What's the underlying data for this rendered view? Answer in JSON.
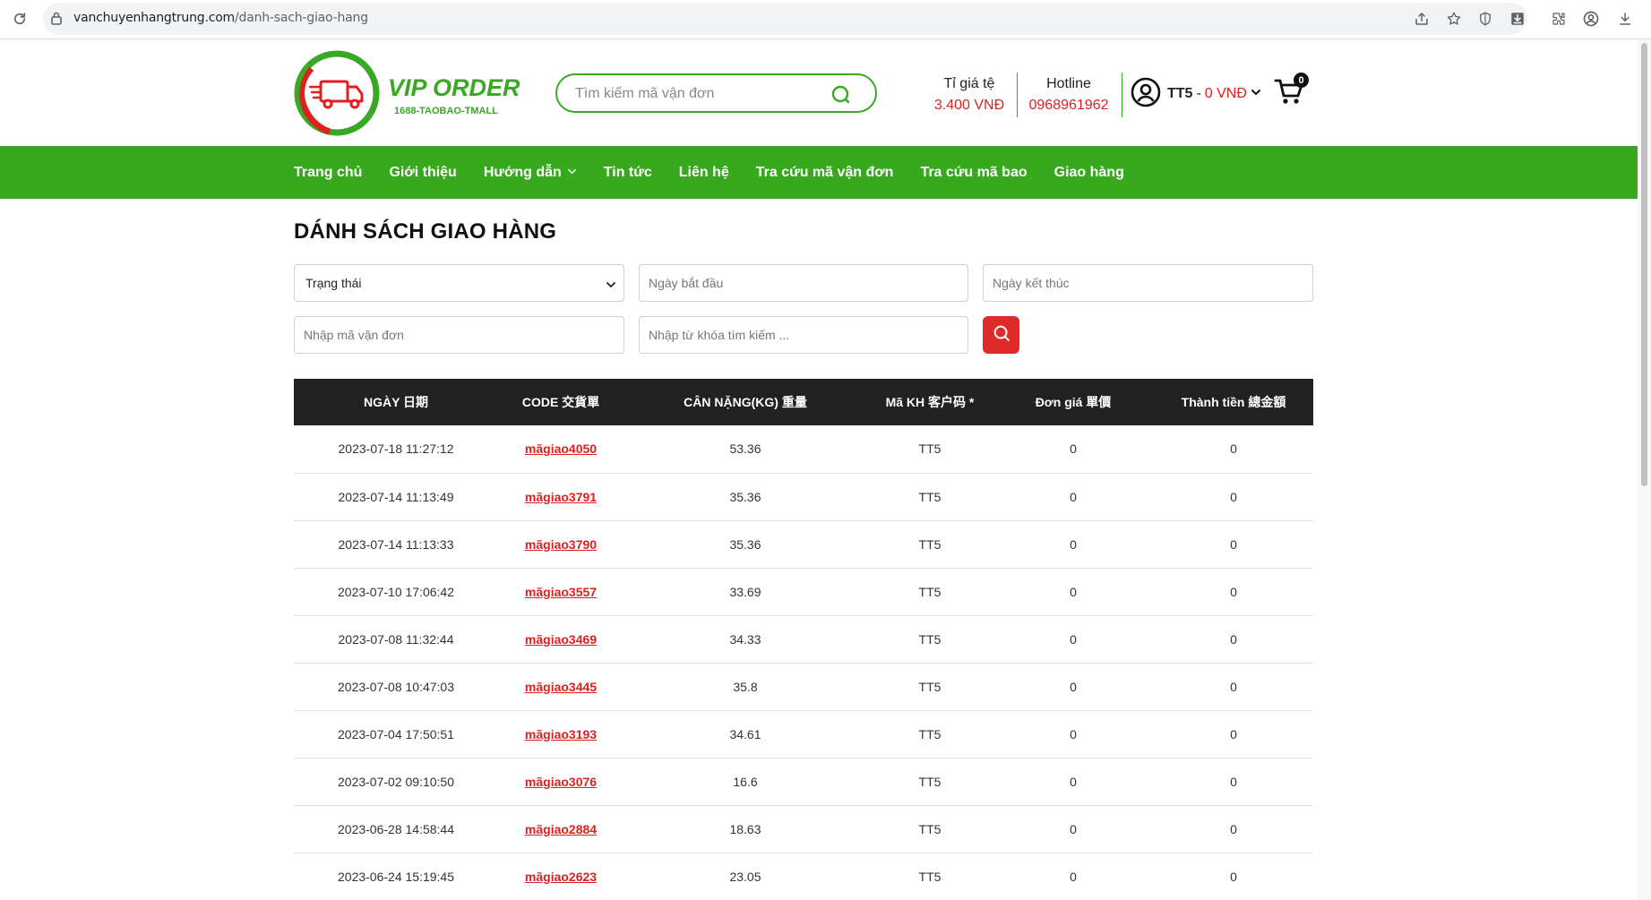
{
  "browser": {
    "url_domain": "vanchuyenhangtrung.com",
    "url_path": "/danh-sach-giao-hang"
  },
  "header": {
    "logo_title": "VIP ORDER",
    "logo_subtitle": "1688-TAOBAO-TMALL",
    "search_placeholder": "Tìm kiếm mã vận đơn",
    "rate_label": "Tỉ giá tệ",
    "rate_value": "3.400 VNĐ",
    "hotline_label": "Hotline",
    "hotline_value": "0968961962",
    "account_name": "TT5",
    "account_sep": "-",
    "account_balance": "0 VNĐ",
    "cart_count": "0"
  },
  "nav": {
    "items": [
      "Trang chủ",
      "Giới thiệu",
      "Hướng dẫn",
      "Tin tức",
      "Liên hệ",
      "Tra cứu mã vận đơn",
      "Tra cứu mã bao",
      "Giao hàng"
    ]
  },
  "main": {
    "title": "DÁNH SÁCH GIAO HÀNG",
    "filters": {
      "status_selected": "Trạng thái",
      "start_date_placeholder": "Ngày bắt đầu",
      "end_date_placeholder": "Ngày kết thúc",
      "code_placeholder": "Nhập mã vận đơn",
      "keyword_placeholder": "Nhập từ khóa tìm kiếm ..."
    },
    "table": {
      "headers": [
        "NGÀY 日期",
        "CODE 交貨單",
        "CÂN NẶNG(KG) 重量",
        "Mã KH 客户码 *",
        "Đơn giá 單價",
        "Thành tiền 總金額"
      ],
      "rows": [
        [
          "2023-07-18 11:27:12",
          "mãgiao4050",
          "53.36",
          "TT5",
          "0",
          "0"
        ],
        [
          "2023-07-14 11:13:49",
          "mãgiao3791",
          "35.36",
          "TT5",
          "0",
          "0"
        ],
        [
          "2023-07-14 11:13:33",
          "mãgiao3790",
          "35.36",
          "TT5",
          "0",
          "0"
        ],
        [
          "2023-07-10 17:06:42",
          "mãgiao3557",
          "33.69",
          "TT5",
          "0",
          "0"
        ],
        [
          "2023-07-08 11:32:44",
          "mãgiao3469",
          "34.33",
          "TT5",
          "0",
          "0"
        ],
        [
          "2023-07-08 10:47:03",
          "mãgiao3445",
          "35.8",
          "TT5",
          "0",
          "0"
        ],
        [
          "2023-07-04 17:50:51",
          "mãgiao3193",
          "34.61",
          "TT5",
          "0",
          "0"
        ],
        [
          "2023-07-02 09:10:50",
          "mãgiao3076",
          "16.6",
          "TT5",
          "0",
          "0"
        ],
        [
          "2023-06-28 14:58:44",
          "mãgiao2884",
          "18.63",
          "TT5",
          "0",
          "0"
        ],
        [
          "2023-06-24 15:19:45",
          "mãgiao2623",
          "23.05",
          "TT5",
          "0",
          "0"
        ]
      ]
    }
  },
  "colors": {
    "brand_green": "#38a81f",
    "accent_red": "#e02020",
    "table_header": "#212121"
  }
}
